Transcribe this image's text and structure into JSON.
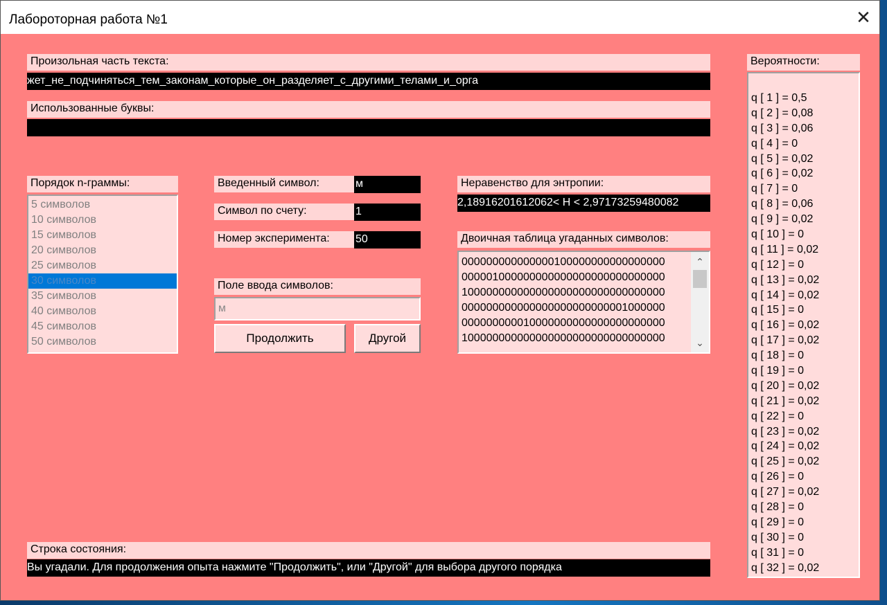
{
  "window": {
    "title": "Лабороторная работа №1",
    "close_glyph": "✕"
  },
  "text_section": {
    "label": "Произольная часть текста:",
    "value": "жет_не_подчиняться_тем_законам_которые_он_разделяет_с_другими_телами_и_орга"
  },
  "used_letters": {
    "label": "Использованные буквы:",
    "value": ""
  },
  "ngram": {
    "label": "Порядок n-граммы:",
    "items": [
      "5 символов",
      "10 символов",
      "15 символов",
      "20 символов",
      "25 символов",
      "30 символов",
      "35 символов",
      "40 символов",
      "45 символов",
      "50 символов"
    ],
    "selected": "30 символов"
  },
  "fields": {
    "entered_symbol_label": "Введенный символ:",
    "entered_symbol_value": "м",
    "symbol_count_label": "Символ по счету:",
    "symbol_count_value": "1",
    "experiment_label": "Номер эксперимента:",
    "experiment_value": "50"
  },
  "input": {
    "label": "Поле ввода символов:",
    "value": "м"
  },
  "buttons": {
    "continue": "Продолжить",
    "other": "Другой"
  },
  "entropy": {
    "label": "Неравенство для энтропии:",
    "value": "2,18916201612062< H < 2,97173259480082"
  },
  "binary_table": {
    "label": "Двоичная таблица угаданных символов:",
    "rows": [
      "000000000000000100000000000000000",
      "000001000000000000000000000000000",
      "100000000000000000000000000000000",
      "000000000000000000000000001000000",
      "000000000010000000000000000000000",
      "100000000000000000000000000000000"
    ],
    "scroll_up": "⌃",
    "scroll_down": "⌄"
  },
  "status": {
    "label": "Строка состояния:",
    "value": "Вы угадали. Для продолжения опыта нажмите \"Продолжить\", или \"Другой\" для выбора другого порядка"
  },
  "probabilities": {
    "label": "Вероятности:",
    "items": [
      "q [ 1 ] = 0,5",
      "q [ 2 ] = 0,08",
      "q [ 3 ] = 0,06",
      "q [ 4 ] = 0",
      "q [ 5 ] = 0,02",
      "q [ 6 ] = 0,02",
      "q [ 7 ] = 0",
      "q [ 8 ] = 0,06",
      "q [ 9 ] = 0,02",
      "q [ 10 ] = 0",
      "q [ 11 ] = 0,02",
      "q [ 12 ] = 0",
      "q [ 13 ] = 0,02",
      "q [ 14 ] = 0,02",
      "q [ 15 ] = 0",
      "q [ 16 ] = 0,02",
      "q [ 17 ] = 0,02",
      "q [ 18 ] = 0",
      "q [ 19 ] = 0",
      "q [ 20 ] = 0,02",
      "q [ 21 ] = 0,02",
      "q [ 22 ] = 0",
      "q [ 23 ] = 0,02",
      "q [ 24 ] = 0,02",
      "q [ 25 ] = 0,02",
      "q [ 26 ] = 0",
      "q [ 27 ] = 0,02",
      "q [ 28 ] = 0",
      "q [ 29 ] = 0",
      "q [ 30 ] = 0",
      "q [ 31 ] = 0",
      "q [ 32 ] = 0,02"
    ]
  },
  "colors": {
    "window_bg": "#ff8080",
    "label_bg": "#ffd6d6",
    "dark_box": "#000000",
    "selection": "#0078d7"
  }
}
